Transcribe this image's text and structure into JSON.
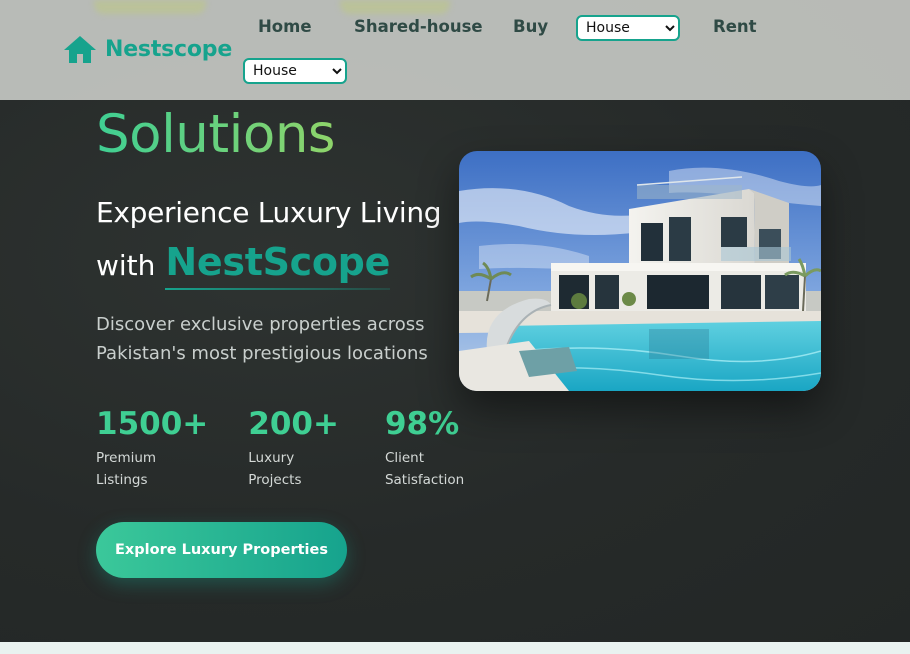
{
  "nav": {
    "brand": "Nestscope",
    "links": [
      "Home",
      "Shared-house",
      "Buy",
      "Rent"
    ],
    "buy_select": {
      "selected": "House",
      "options": [
        "House"
      ]
    },
    "rent_select": {
      "selected": "House",
      "options": [
        "House"
      ]
    }
  },
  "hero": {
    "title": "Solutions",
    "subtitle": "Experience Luxury Living",
    "with_word": "with",
    "brand_highlight": "NestScope",
    "description": "Discover exclusive properties across Pakistan's most prestigious locations",
    "stats": [
      {
        "value": "1500+",
        "label": "Premium Listings"
      },
      {
        "value": "200+",
        "label": "Luxury Projects"
      },
      {
        "value": "98%",
        "label": "Client Satisfaction"
      }
    ],
    "cta_label": "Explore Luxury Properties"
  },
  "colors": {
    "accent": "#16a38d",
    "accent_light": "#3fcf93",
    "hero_bg": "#262a29",
    "navbar_bg": "#c4c6c2"
  },
  "icons": {
    "logo": "house-icon"
  }
}
